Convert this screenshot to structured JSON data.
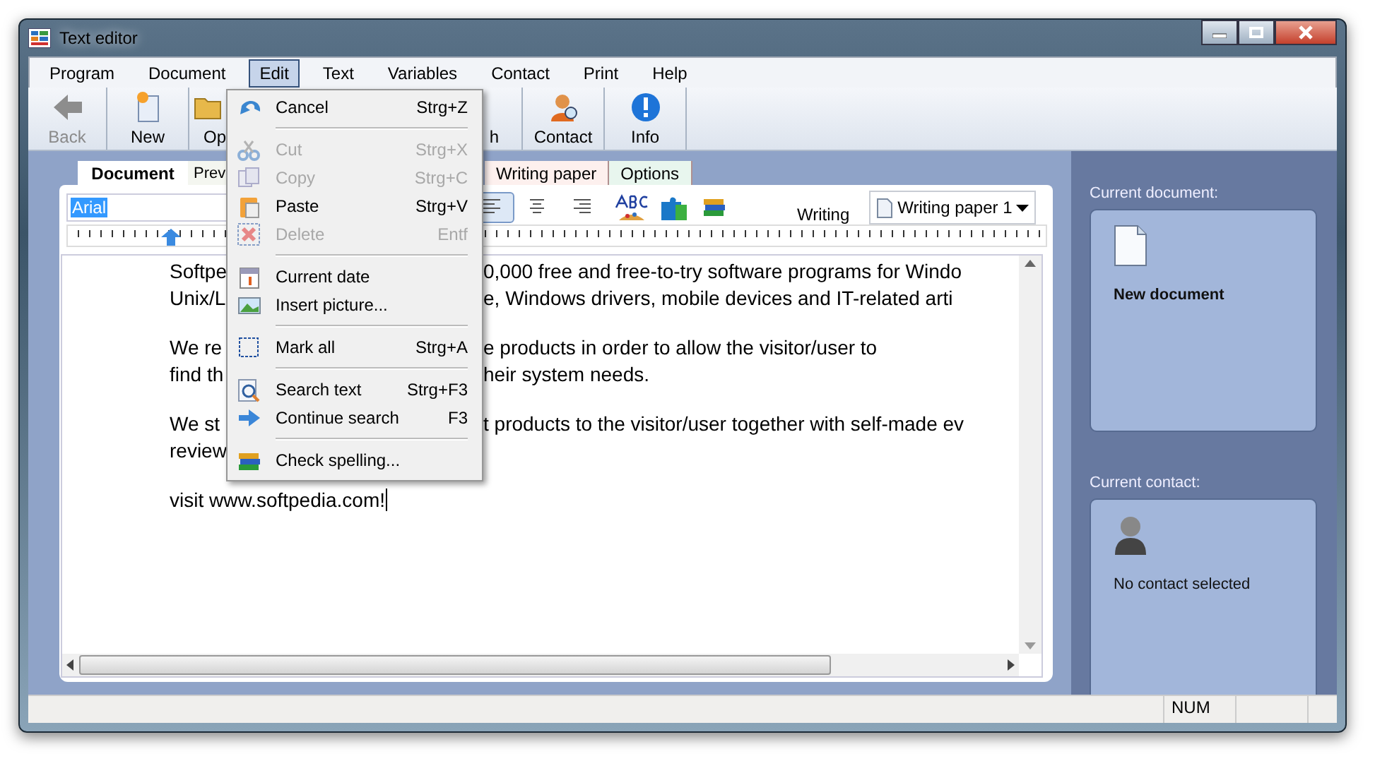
{
  "window": {
    "title": "Text editor"
  },
  "menubar": [
    {
      "label": "Program",
      "selected": false
    },
    {
      "label": "Document",
      "selected": false
    },
    {
      "label": "Edit",
      "selected": true
    },
    {
      "label": "Text",
      "selected": false
    },
    {
      "label": "Variables",
      "selected": false
    },
    {
      "label": "Contact",
      "selected": false
    },
    {
      "label": "Print",
      "selected": false
    },
    {
      "label": "Help",
      "selected": false
    }
  ],
  "toolbar": [
    {
      "kind": "back",
      "label": "Back",
      "disabled": true
    },
    {
      "kind": "new",
      "label": "New",
      "disabled": false
    },
    {
      "kind": "open",
      "label": "Op",
      "disabled": false
    },
    {
      "kind": "search",
      "label": "h",
      "disabled": false
    },
    {
      "kind": "contact",
      "label": "Contact",
      "disabled": false
    },
    {
      "kind": "info",
      "label": "Info",
      "disabled": false
    }
  ],
  "tabs": [
    {
      "label": "Document",
      "selected": true
    },
    {
      "label": "Prev",
      "selected": false
    },
    {
      "label": "Writing paper",
      "selected": false
    },
    {
      "label": "Options",
      "selected": false
    }
  ],
  "format_bar": {
    "font_field": {
      "value": "Arial",
      "highlighted": true
    },
    "align_buttons": [
      {
        "kind": "left",
        "selected": true
      },
      {
        "kind": "center",
        "selected": false
      },
      {
        "kind": "right",
        "selected": false
      }
    ],
    "writing_label": "Writing",
    "paper_dropdown": "Writing paper 1"
  },
  "document": {
    "paragraphs": [
      {
        "lines": [
          {
            "left": "Softpe",
            "right": "0,000 free and free-to-try software programs for Windo"
          },
          {
            "left": "Unix/L",
            "right": "e, Windows drivers, mobile devices and IT-related arti"
          }
        ]
      },
      {
        "lines": [
          {
            "left": "We re",
            "right": "e products in order to allow the visitor/user to"
          },
          {
            "left": "find th",
            "right": "heir system needs."
          }
        ]
      },
      {
        "lines": [
          {
            "left": "We st",
            "right": "t products to the visitor/user together with self-made ev"
          },
          {
            "left": "review"
          }
        ]
      },
      {
        "lines": [
          {
            "left": "visit www.softpedia.com!"
          }
        ]
      }
    ]
  },
  "edit_menu": [
    {
      "kind": "item",
      "label": "Cancel",
      "shortcut": "Strg+Z",
      "disabled": false
    },
    {
      "kind": "separator"
    },
    {
      "kind": "item",
      "label": "Cut",
      "shortcut": "Strg+X",
      "disabled": true
    },
    {
      "kind": "item",
      "label": "Copy",
      "shortcut": "Strg+C",
      "disabled": true
    },
    {
      "kind": "item",
      "label": "Paste",
      "shortcut": "Strg+V",
      "disabled": false
    },
    {
      "kind": "item",
      "label": "Delete",
      "shortcut": "Entf",
      "disabled": true
    },
    {
      "kind": "separator"
    },
    {
      "kind": "item",
      "label": "Current date",
      "disabled": false
    },
    {
      "kind": "item",
      "label": "Insert picture...",
      "disabled": false
    },
    {
      "kind": "separator"
    },
    {
      "kind": "item",
      "label": "Mark all",
      "shortcut": "Strg+A",
      "disabled": false
    },
    {
      "kind": "separator"
    },
    {
      "kind": "item",
      "label": "Search text",
      "shortcut": "Strg+F3",
      "disabled": false
    },
    {
      "kind": "item",
      "label": "Continue search",
      "shortcut": "F3",
      "disabled": false
    },
    {
      "kind": "separator"
    },
    {
      "kind": "item",
      "label": "Check spelling...",
      "disabled": false
    }
  ],
  "sidebar": {
    "document_label": "Current document:",
    "document_name": "New document",
    "contact_label": "Current contact:",
    "contact_name": "No contact selected"
  },
  "status_bar": [
    "NUM"
  ]
}
